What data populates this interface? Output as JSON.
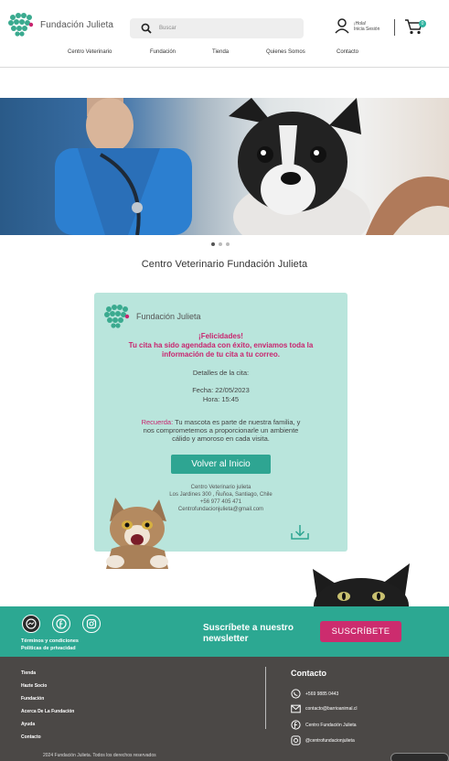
{
  "header": {
    "logo_text": "Fundación Julieta",
    "search_placeholder": "Buscar",
    "user_greeting": "¡Hola!",
    "user_login": "Inicia Sesión",
    "cart_count": "0"
  },
  "nav": {
    "items": [
      "Centro Veterinario",
      "Fundación",
      "Tienda",
      "Quienes Somos",
      "Contacto"
    ]
  },
  "carousel": {
    "total": 3,
    "active": 1
  },
  "page_title": "Centro Veterinario Fundación Julieta",
  "card": {
    "logo_text": "Fundación Julieta",
    "congrats": "¡Felicidades!",
    "msg_line1": "Tu cita ha sido agendada con éxito, enviamos toda la",
    "msg_line2": "información de tu cita a tu correo.",
    "details_label": "Detalles de la cita:",
    "date": "Fecha: 22/05/2023",
    "time": "Hora: 15:45",
    "reminder_label": "Recuerda:",
    "reminder_1": "Tu mascota es parte de nuestra familia, y",
    "reminder_2": "nos comprometemos a proporcionarle un ambiente",
    "reminder_3": "cálido y amoroso en cada visita.",
    "button": "Volver al Inicio",
    "info_name": "Centro Veterinario julieta",
    "info_address": "Los Jardines 300 , Ñuñoa, Santiago, Chile",
    "info_phone": "+56 977 405 471",
    "info_email": "Centrofundacionjulieta@gmail.com"
  },
  "newsletter": {
    "terms": "Términos y condiciones",
    "privacy": "Políticas de privacidad",
    "title_1": "Suscríbete a nuestro",
    "title_2": "newsletter",
    "button": "SUSCRÍBETE"
  },
  "footer": {
    "links": [
      "Tienda",
      "Hazte Socio",
      "Fundación",
      "Acerca De La  Fundación",
      "Ayuda",
      "Contacto"
    ],
    "contact_title": "Contacto",
    "phone": "+569 9885 0443",
    "email": "contacto@barrioanimal.cl",
    "facebook": "Centro Fundación Julieta",
    "instagram": "@centrofundacionjulieta",
    "copyright": "2024 Fundación Julieta. Todos los derechos reservados"
  },
  "colors": {
    "brand_teal": "#2ca892",
    "card_bg": "#b9e5dc",
    "accent_pink": "#c8246e",
    "footer_dark": "#4b4846"
  }
}
